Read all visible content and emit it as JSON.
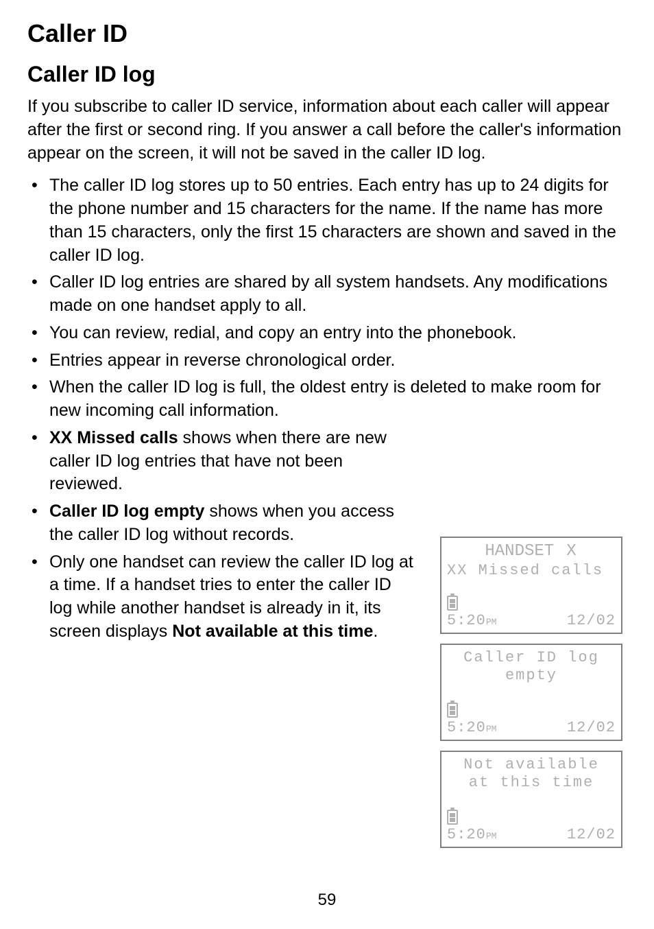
{
  "title": "Caller ID",
  "subtitle": "Caller ID log",
  "intro": "If you subscribe to caller ID service, information about each caller will appear after the first or second ring. If you answer a call before the caller's information appear on the screen, it will not be saved in the caller ID log.",
  "bullets": {
    "b1": "The caller ID log stores up to 50 entries. Each entry has up to 24 digits for the phone number and 15 characters for the name. If the name has more than 15 characters, only the first 15 characters are shown and saved in the caller ID log.",
    "b2": "Caller ID log entries are shared by all system handsets. Any modifications made on one handset apply to all.",
    "b3": "You can review, redial, and copy an entry into the phonebook.",
    "b4": "Entries appear in reverse chronological order.",
    "b5": "When the caller ID log is full, the oldest entry is deleted to make room for new incoming call information.",
    "b6_bold": "XX Missed calls",
    "b6_rest": " shows when there are new caller ID log entries that have not been reviewed.",
    "b7_bold": "Caller ID log empty",
    "b7_rest": " shows when you access the caller ID log without records.",
    "b8_pre": "Only one handset can review the caller ID log at a time. If a handset tries to enter the caller ID log while another handset is already in it, its screen displays ",
    "b8_bold": "Not available at this time",
    "b8_post": "."
  },
  "screens": {
    "s1": {
      "line1a": "HANDSET",
      "line1b": "X",
      "line2": "XX Missed calls",
      "time": "5:20",
      "pm": "PM",
      "date": "12/02"
    },
    "s2": {
      "line1": "Caller ID log",
      "line2": "empty",
      "time": "5:20",
      "pm": "PM",
      "date": "12/02"
    },
    "s3": {
      "line1": "Not available",
      "line2": "at this time",
      "time": "5:20",
      "pm": "PM",
      "date": "12/02"
    }
  },
  "page_number": "59"
}
